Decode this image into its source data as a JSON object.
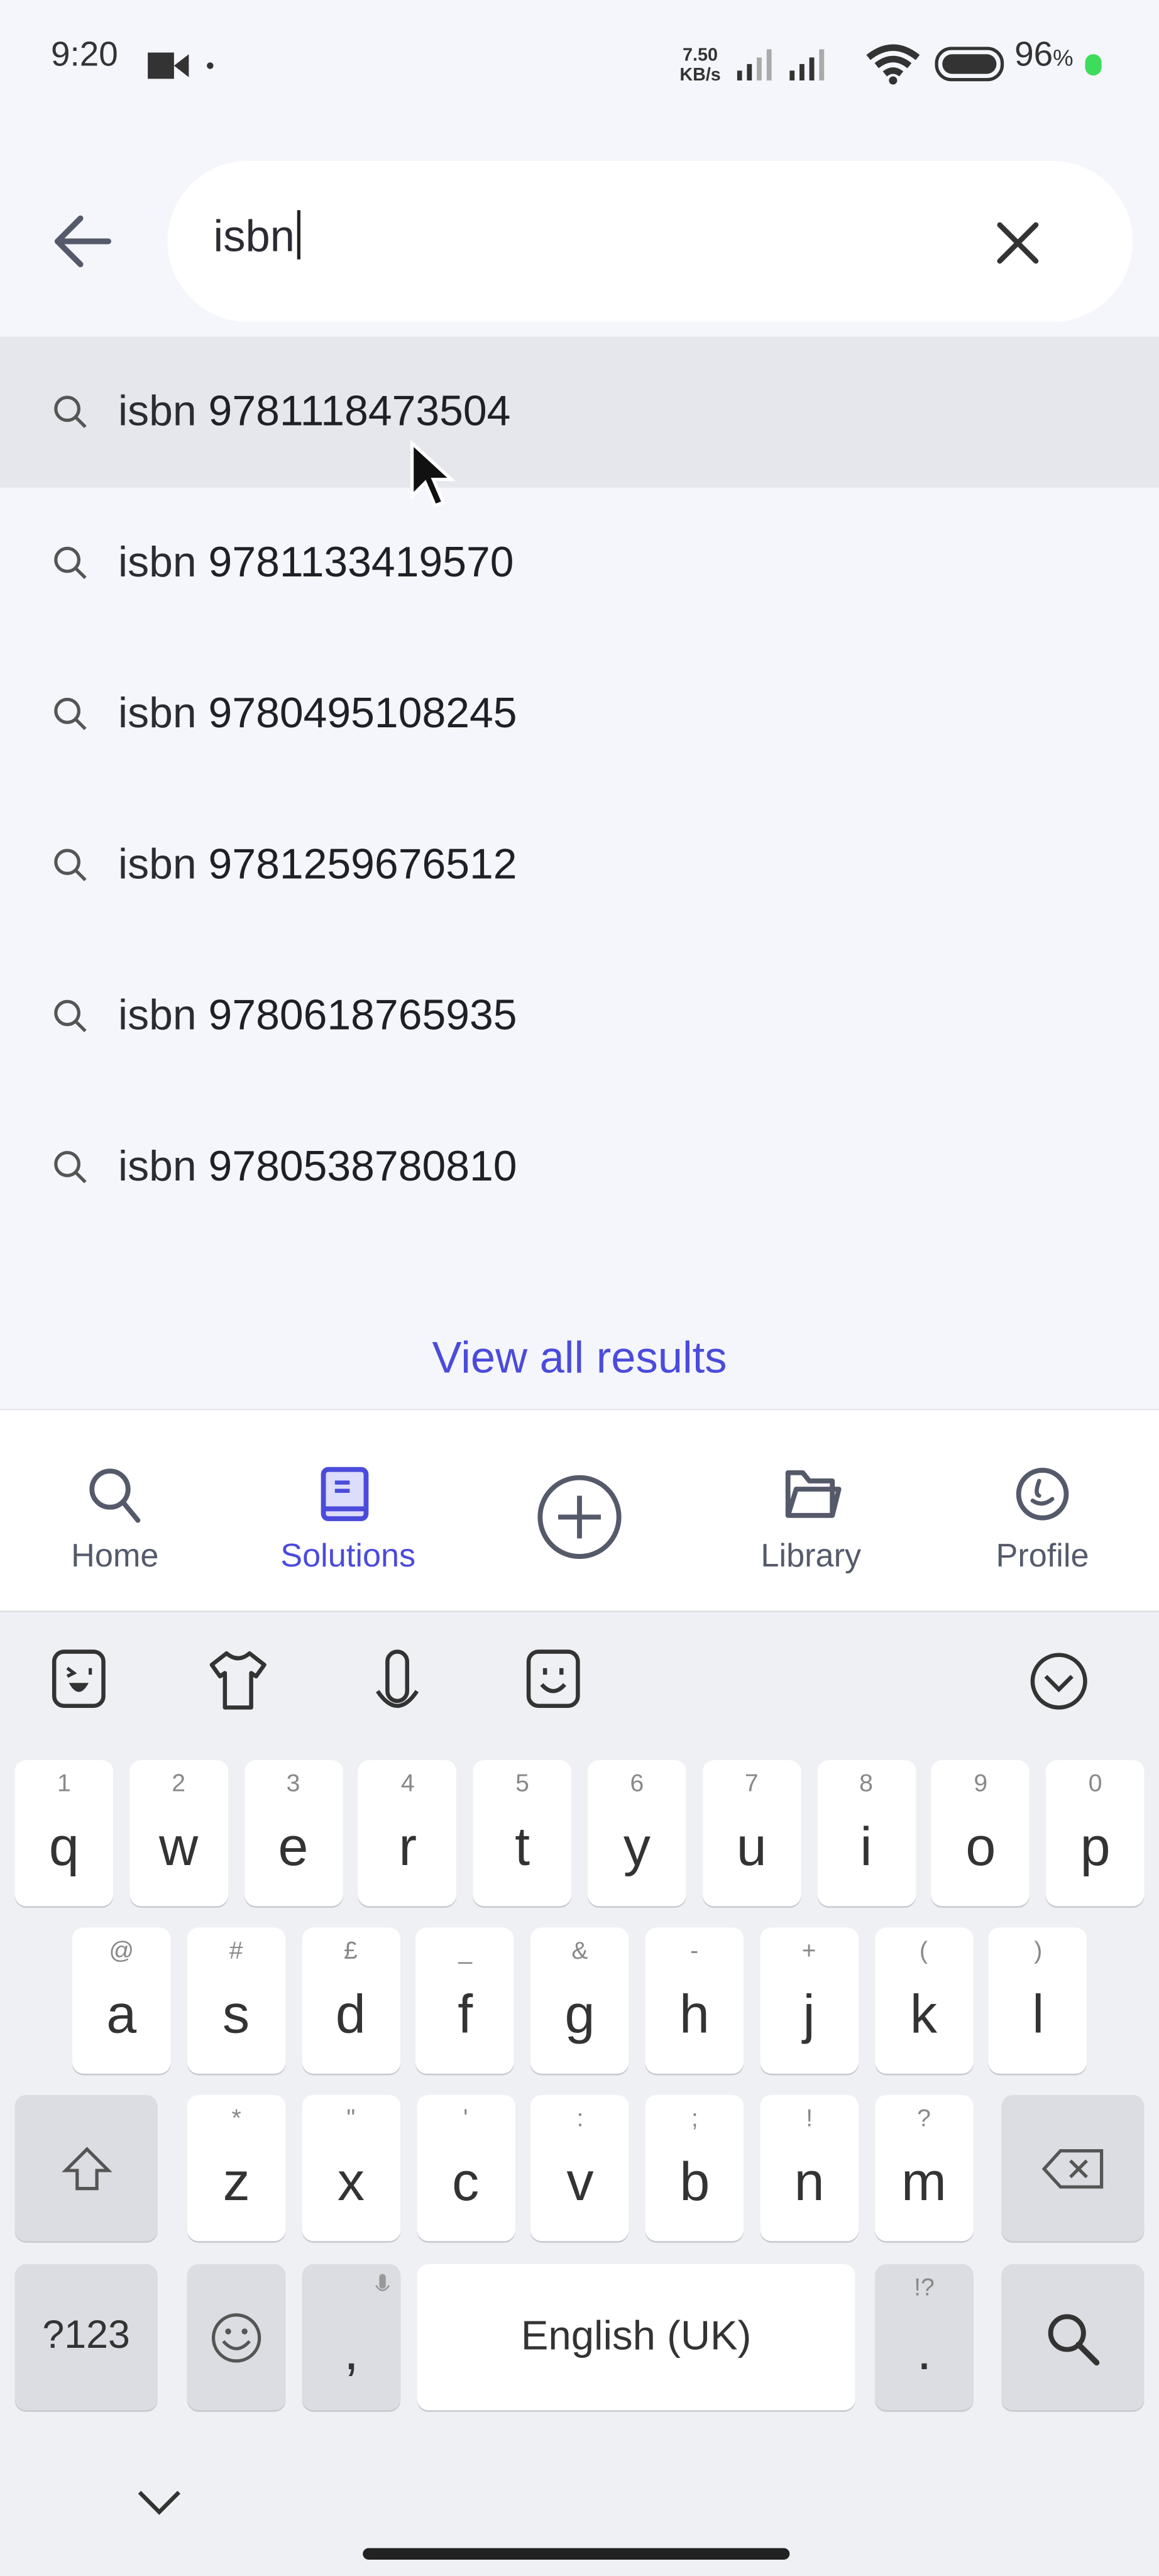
{
  "status_bar": {
    "time": "9:20",
    "net_speed_value": "7.50",
    "net_speed_unit": "KB/s",
    "battery": "96",
    "battery_unit": "%",
    "icons": [
      "video-camera-icon",
      "dot-icon",
      "signal-icon",
      "signal-icon",
      "wifi-icon",
      "battery-icon",
      "charging-dot-icon"
    ],
    "charging_color": "#3ddc5a"
  },
  "search": {
    "back_icon": "arrow-left-icon",
    "query": "isbn",
    "clear_icon": "close-icon"
  },
  "suggestions": [
    {
      "prefix": "isbn",
      "value": "9781118473504",
      "highlighted": true
    },
    {
      "prefix": "isbn",
      "value": "9781133419570"
    },
    {
      "prefix": "isbn",
      "value": "9780495108245"
    },
    {
      "prefix": "isbn",
      "value": "9781259676512"
    },
    {
      "prefix": "isbn",
      "value": "9780618765935"
    },
    {
      "prefix": "isbn",
      "value": "9780538780810"
    }
  ],
  "view_all": "View all results",
  "bottom_nav": {
    "items": [
      {
        "label": "Home",
        "icon": "search-icon"
      },
      {
        "label": "Solutions",
        "icon": "book-icon",
        "active": true
      },
      {
        "label": "",
        "icon": "plus-circle-icon"
      },
      {
        "label": "Library",
        "icon": "folder-icon"
      },
      {
        "label": "Profile",
        "icon": "profile-icon"
      }
    ],
    "accent": "#4b4bdb"
  },
  "keyboard": {
    "toolbar": [
      "sticker-icon",
      "theme-shirt-icon",
      "microphone-icon",
      "emoji-sticker-icon",
      "collapse-chevron-icon"
    ],
    "row1": [
      [
        "q",
        "1"
      ],
      [
        "w",
        "2"
      ],
      [
        "e",
        "3"
      ],
      [
        "r",
        "4"
      ],
      [
        "t",
        "5"
      ],
      [
        "y",
        "6"
      ],
      [
        "u",
        "7"
      ],
      [
        "i",
        "8"
      ],
      [
        "o",
        "9"
      ],
      [
        "p",
        "0"
      ]
    ],
    "row2": [
      [
        "a",
        "@"
      ],
      [
        "s",
        "#"
      ],
      [
        "d",
        "£"
      ],
      [
        "f",
        "_"
      ],
      [
        "g",
        "&"
      ],
      [
        "h",
        "-"
      ],
      [
        "j",
        "+"
      ],
      [
        "k",
        "("
      ],
      [
        "l",
        ")"
      ]
    ],
    "row3": [
      [
        "z",
        "*"
      ],
      [
        "x",
        "\""
      ],
      [
        "c",
        "'"
      ],
      [
        "v",
        ":"
      ],
      [
        "b",
        ";"
      ],
      [
        "n",
        "!"
      ],
      [
        "m",
        "?"
      ]
    ],
    "symbols": "?123",
    "comma": ",",
    "period": ".",
    "period_hint": "!?",
    "space": "English (UK)",
    "shift_icon": "shift-icon",
    "backspace_icon": "backspace-icon",
    "emoji_icon": "emoji-icon",
    "search_icon": "search-icon",
    "mic_hint_icon": "mic-icon",
    "hide_icon": "chevron-down-icon"
  }
}
